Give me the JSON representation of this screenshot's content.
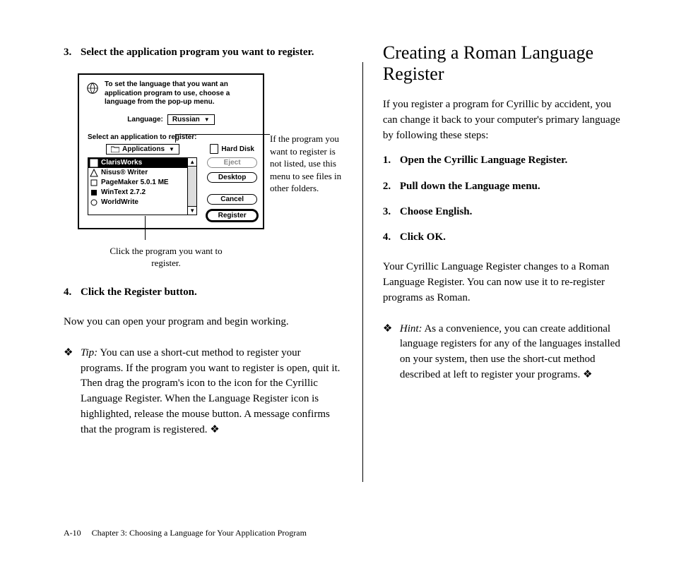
{
  "left": {
    "step3_num": "3.",
    "step3_text": "Select the application program you want to register.",
    "step4_num": "4.",
    "step4_text": "Click the Register button.",
    "after_step4": "Now you can open your program and begin working.",
    "tip_label": "Tip:",
    "tip_text": " You can use a short-cut method to register your programs. If the program you want to register is open, quit it. Then drag the program's icon to the icon for the Cyrillic Language Register. When the Language Register icon is highlighted, release the mouse button. A message confirms that the program is registered.  ❖",
    "callout_right": "If the program you want to register is not listed, use this menu to see files in other folders.",
    "callout_below": "Click the program you want to register."
  },
  "dialog": {
    "message": "To set the language that you want an application program to use, choose a language from the pop-up menu.",
    "language_label": "Language:",
    "language_value": "Russian",
    "select_label": "Select an application to register:",
    "folder_popup": "Applications",
    "disk_label": "Hard Disk",
    "list": [
      "ClarisWorks",
      "Nisus® Writer",
      "PageMaker 5.0.1 ME",
      "WinText 2.7.2",
      "WorldWrite"
    ],
    "buttons": {
      "eject": "Eject",
      "desktop": "Desktop",
      "cancel": "Cancel",
      "register": "Register"
    }
  },
  "right": {
    "heading": "Creating a Roman Language Register",
    "intro": "If you register a program for Cyrillic by accident, you can change it back to your computer's primary language by following these steps:",
    "s1_num": "1.",
    "s1": "Open the Cyrillic Language Register.",
    "s2_num": "2.",
    "s2": "Pull down the Language menu.",
    "s3_num": "3.",
    "s3": "Choose English.",
    "s4_num": "4.",
    "s4": "Click OK.",
    "after": "Your Cyrillic Language Register changes to a Roman Language Register. You can now use it to re-register programs as Roman.",
    "hint_label": "Hint:",
    "hint_text": " As a convenience, you can create additional language registers for any of the languages installed on your system, then use the short-cut method described at left to register your programs.  ❖"
  },
  "footer": {
    "page": "A-10",
    "chapter": "Chapter 3: Choosing a Language for Your Application Program"
  },
  "glyphs": {
    "diamond": "❖",
    "tri_down": "▼",
    "tri_up": "▲"
  }
}
